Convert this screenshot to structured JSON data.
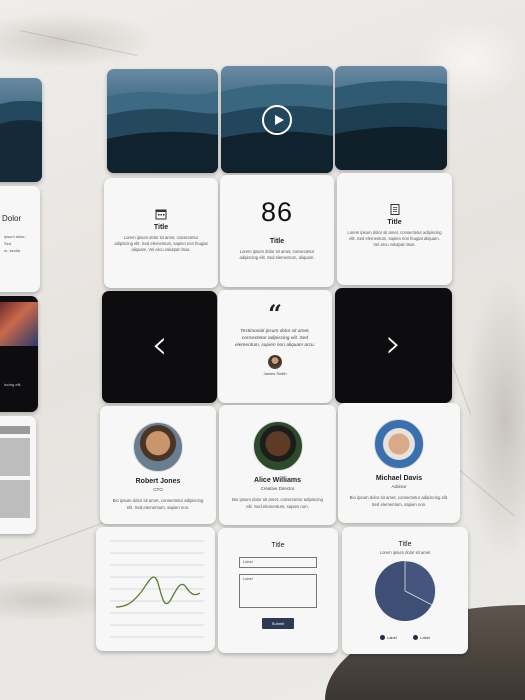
{
  "scene": "printed-ui-cards-on-marble-table",
  "info_cards": [
    {
      "title": "Title",
      "body": "Lorem ipsum dolor sit amet, consectetur adipiscing elit. Sed elementum, sapien non feugiat aliquam. Vel arcu volutpat risus."
    },
    {
      "number": "86",
      "title": "Title",
      "body": "Lorem ipsum dolor sit amet, consectetur adipiscing elit. Sed elementum, aliquam."
    },
    {
      "title": "Title",
      "body": "Lorem ipsum dolor sit amet, consectetur adipiscing elit. Sed elementum, sapien non feugiat aliquam. Vel arcu volutpat risus."
    }
  ],
  "testimonial": {
    "quote_mark": "“",
    "text": "Testimonial ipsum dolor sit amet, consectetur adipiscing elit. Sed elementum, sapien non aliquam arcu.",
    "name": "James Smith"
  },
  "nav": {
    "prev": "‹",
    "next": "›"
  },
  "profiles": [
    {
      "name": "Robert Jones",
      "role": "CTO",
      "body": "Bio ipsum dolor sit amet, consectetur adipiscing elit. Sed elementum, sapien non."
    },
    {
      "name": "Alice Williams",
      "role": "Creative Director",
      "body": "Bio ipsum dolor sit amet, consectetur adipiscing elit. Sed elementum, sapien non."
    },
    {
      "name": "Michael Davis",
      "role": "Advisor",
      "body": "Bio ipsum dolor sit amet, consectetur adipiscing elit. Sed elementum, sapien non."
    }
  ],
  "form": {
    "title": "Title",
    "field1_label": "Label",
    "field2_label": "Label",
    "submit_label": "Submit"
  },
  "pie_card": {
    "title": "Title",
    "subtitle": "Lorem ipsum dolor sit amet",
    "legend1": "Label",
    "legend2": "Label"
  },
  "partial_cards": {
    "dolor": "Dolor",
    "snippet1": "ipsum dolor,",
    "snippet2": "Sed ",
    "snippet3": "m, sectia",
    "snippet4": "iscing elit."
  },
  "colors": {
    "navy": "#2c3a56",
    "card": "#f7f7f7",
    "dark": "#0d0d0f",
    "chart_line": "#6b7d3a",
    "pie": "#3e4f75"
  }
}
